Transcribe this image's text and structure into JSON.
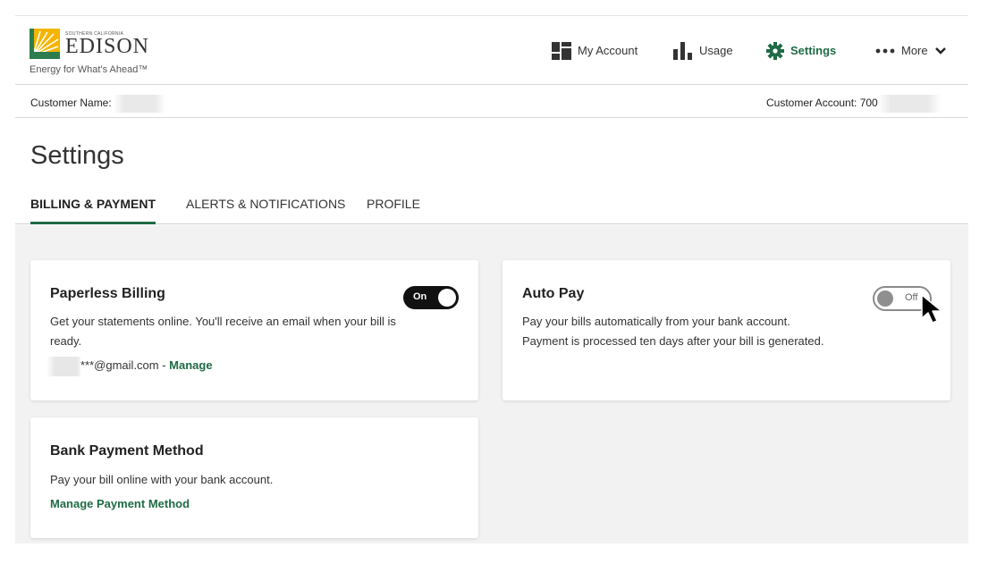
{
  "logo": {
    "small_text": "SOUTHERN CALIFORNIA",
    "name": "EDISON",
    "tagline": "Energy for What's Ahead™"
  },
  "nav": {
    "items": [
      {
        "label": "My Account",
        "icon": "grid-icon"
      },
      {
        "label": "Usage",
        "icon": "bar-chart-icon"
      },
      {
        "label": "Settings",
        "icon": "gear-icon",
        "active": true
      },
      {
        "label": "More",
        "icon": "dots-icon"
      }
    ]
  },
  "customer": {
    "name_label": "Customer Name:",
    "account_label": "Customer Account: 700"
  },
  "page": {
    "title": "Settings"
  },
  "tabs": [
    {
      "label": "BILLING & PAYMENT",
      "active": true
    },
    {
      "label": "ALERTS & NOTIFICATIONS",
      "active": false
    },
    {
      "label": "PROFILE",
      "active": false
    }
  ],
  "cards": {
    "paperless": {
      "title": "Paperless Billing",
      "description": "Get your statements online. You'll receive an email when your bill is ready.",
      "email": "***@gmail.com - ",
      "manage_link": "Manage",
      "toggle_label": "On"
    },
    "autopay": {
      "title": "Auto Pay",
      "description_line1": "Pay your bills automatically from your bank account.",
      "description_line2": "Payment is processed ten days after your bill is generated.",
      "toggle_label": "Off"
    },
    "bank": {
      "title": "Bank Payment Method",
      "description": "Pay your bill online with your bank account.",
      "manage_link": "Manage Payment Method"
    }
  },
  "colors": {
    "accent_green": "#1f6b45",
    "logo_yellow": "#f4b400",
    "logo_green": "#2e7d4f"
  }
}
